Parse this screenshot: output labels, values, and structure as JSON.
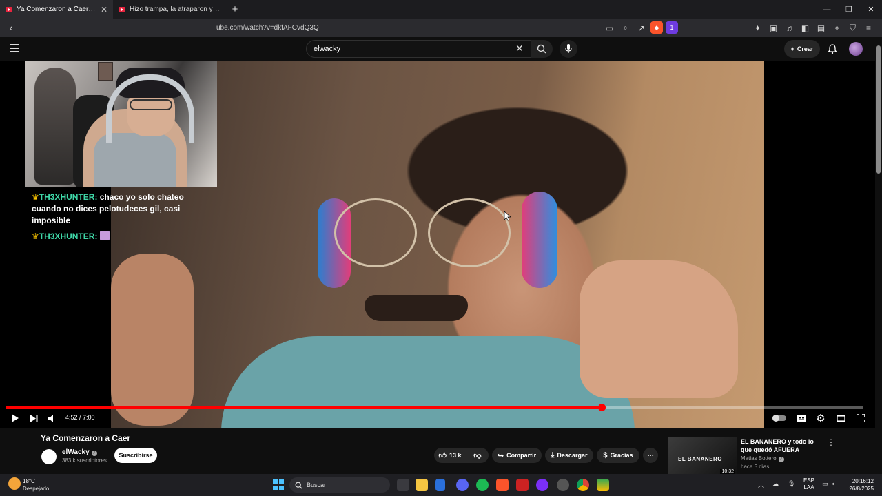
{
  "browser": {
    "tabs": [
      {
        "title": "Ya Comenzaron a Caer - YouTube",
        "active": true
      },
      {
        "title": "Hizo trampa, la atraparon y CULPÓ a",
        "active": false
      }
    ],
    "url": "ube.com/watch?v=dkfAFCvdQ3Q",
    "extension_badge": "1"
  },
  "youtube": {
    "search_query": "elwacky",
    "create_label": "Crear"
  },
  "overlay_chat": [
    {
      "user": "TH3XHUNTER:",
      "text": " chaco yo solo chateo cuando no dices pelotudeces gil, casi imposible"
    },
    {
      "user": "TH3XHUNTER:",
      "text": " "
    }
  ],
  "player": {
    "current_time": "4:52",
    "duration": "7:00",
    "time_display": "4:52 / 7:00",
    "progress_fraction": 0.695
  },
  "video": {
    "title": "Ya Comenzaron a Caer",
    "channel": "elWacky",
    "subscribers": "383 k suscriptores",
    "subscribe_label": "Suscribirse",
    "likes": "13 k",
    "share_label": "Compartir",
    "download_label": "Descargar",
    "thanks_label": "Gracias"
  },
  "recommended": {
    "title": "EL BANANERO y todo lo que quedó AFUERA",
    "channel": "Matias Bottero",
    "age": "hace 5 días",
    "duration": "10:32",
    "thumb_text": "EL BANANERO"
  },
  "taskbar": {
    "temperature": "18°C",
    "weather": "Despejado",
    "search_label": "Buscar",
    "lang_line1": "ESP",
    "lang_line2": "LAA",
    "time": "20:16:12",
    "date": "26/8/2025"
  },
  "colors": {
    "accent_red": "#ff0000",
    "chat_user": "#3fd8a8",
    "crown": "#f7c300"
  }
}
